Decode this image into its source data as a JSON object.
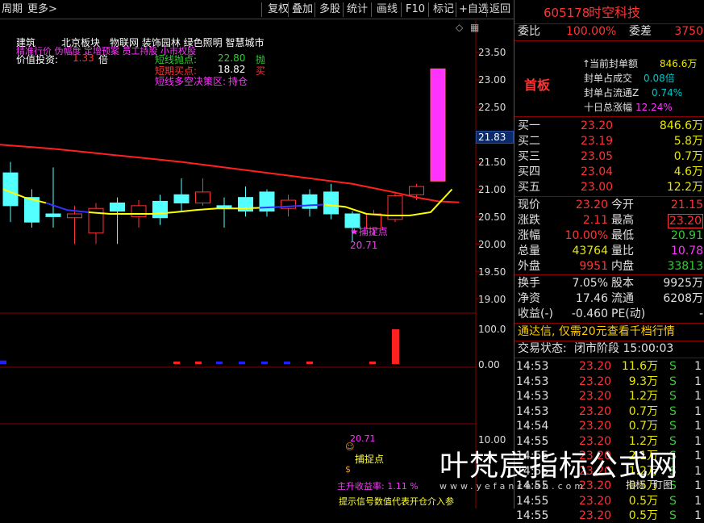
{
  "toolbar": {
    "left": [
      "周期",
      "更多>"
    ],
    "right": [
      "复权",
      "叠加",
      "多股",
      "统计",
      "画线",
      "F10",
      "标记",
      "+自选",
      "返回"
    ]
  },
  "chart_info": {
    "line1": [
      "建筑",
      "北京板块",
      "物联网 装饰园林 绿色照明 智慧城市"
    ],
    "line1b": "精准行价 伪幅度 定增预案 员工持股 小市权股",
    "value_label": "价值投资:",
    "value": "1.33",
    "value_unit": "倍",
    "short_sell_label": "短线抛点:",
    "short_sell": "22.80",
    "short_sell_tag": "抛",
    "short_buy_label": "短期买点:",
    "short_buy": "18.82",
    "short_buy_tag": "买",
    "strategy_label": "短线多空决策区:",
    "strategy": "持仓",
    "current_price_tag": "21.83",
    "capture_label": "★捕捉点",
    "capture_price": "20.71"
  },
  "indicator_bottom": {
    "price": "20.71",
    "capture": "捕捉点",
    "income": "主升收益率: 1.11 %",
    "hint": "提示信号数值代表开仓介入参"
  },
  "price_axis": [
    "23.50",
    "23.00",
    "22.50",
    "22.00",
    "21.50",
    "21.00",
    "20.50",
    "20.00",
    "19.50",
    "19.00"
  ],
  "vol_axis": [
    "100.0",
    "0.00"
  ],
  "ind_axis": [
    "10.00"
  ],
  "chart_data": {
    "type": "candlestick",
    "ylim": [
      18.8,
      23.7
    ],
    "candles": [
      {
        "o": 21.3,
        "c": 20.7,
        "h": 21.5,
        "l": 20.4
      },
      {
        "o": 20.85,
        "c": 20.4,
        "h": 21.0,
        "l": 20.3
      },
      {
        "o": 20.55,
        "c": 20.5,
        "h": 21.4,
        "l": 20.3
      },
      {
        "o": 20.48,
        "c": 20.55,
        "h": 20.7,
        "l": 20.0
      },
      {
        "o": 20.2,
        "c": 20.65,
        "h": 20.75,
        "l": 20.0
      },
      {
        "o": 20.75,
        "c": 20.6,
        "h": 20.85,
        "l": 20.0
      },
      {
        "o": 20.5,
        "c": 20.7,
        "h": 20.8,
        "l": 20.3
      },
      {
        "o": 20.78,
        "c": 20.48,
        "h": 20.9,
        "l": 20.35
      },
      {
        "o": 20.9,
        "c": 20.75,
        "h": 21.2,
        "l": 20.6
      },
      {
        "o": 20.75,
        "c": 20.95,
        "h": 21.2,
        "l": 20.7
      },
      {
        "o": 20.7,
        "c": 20.65,
        "h": 20.85,
        "l": 20.3
      },
      {
        "o": 20.85,
        "c": 20.6,
        "h": 21.05,
        "l": 20.5
      },
      {
        "o": 20.95,
        "c": 20.6,
        "h": 21.0,
        "l": 20.5
      },
      {
        "o": 20.65,
        "c": 20.8,
        "h": 20.9,
        "l": 20.5
      },
      {
        "o": 20.9,
        "c": 20.65,
        "h": 21.0,
        "l": 20.5
      },
      {
        "o": 20.95,
        "c": 20.55,
        "h": 21.1,
        "l": 20.45
      },
      {
        "o": 20.55,
        "c": 20.3,
        "h": 20.6,
        "l": 20.05
      },
      {
        "o": 20.28,
        "c": 20.55,
        "h": 20.62,
        "l": 20.15
      },
      {
        "o": 20.45,
        "c": 20.88,
        "h": 20.95,
        "l": 20.4
      },
      {
        "o": 20.9,
        "c": 21.05,
        "h": 21.1,
        "l": 20.8
      },
      {
        "o": 21.15,
        "c": 23.2,
        "h": 23.2,
        "l": 21.15
      }
    ],
    "ma_red": [
      21.83,
      21.8,
      21.77,
      21.74,
      21.7,
      21.66,
      21.62,
      21.58,
      21.54,
      21.5,
      21.45,
      21.4,
      21.35,
      21.3,
      21.25,
      21.2,
      21.15,
      21.1,
      21.02,
      20.94,
      20.85,
      20.78,
      20.76
    ],
    "ma_yellow": [
      21.0,
      20.85,
      20.75,
      20.62,
      20.58,
      20.55,
      20.55,
      20.55,
      20.58,
      20.62,
      20.65,
      20.65,
      20.66,
      20.68,
      20.7,
      20.72,
      20.68,
      20.55,
      20.52,
      20.52,
      20.58,
      21.0
    ],
    "volume": [
      {
        "v": 10,
        "up": false
      },
      {
        "v": 4,
        "up": true
      },
      {
        "v": 4,
        "up": true
      },
      {
        "v": 4,
        "up": false
      },
      {
        "v": 4,
        "up": false
      },
      {
        "v": 4,
        "up": false
      },
      {
        "v": 4,
        "up": false
      },
      {
        "v": 4,
        "up": true
      },
      {
        "v": 4,
        "up": true
      },
      {
        "v": 100,
        "up": true
      }
    ]
  },
  "panel": {
    "code": "605178",
    "name": "时空科技",
    "webi_label": "委比",
    "webi": "100.00%",
    "weicha_label": "委差",
    "weicha": "3750",
    "limit_up_label": "首板",
    "seal_amount_label": "当前封单额",
    "seal_amount": "846.6万",
    "seal_ratio_label": "封单占成交",
    "seal_ratio": "0.08倍",
    "seal_float_label": "封单占流通Z",
    "seal_float": "0.74%",
    "ten_day_label": "十日总涨幅",
    "ten_day": "12.24%",
    "bids": [
      {
        "label": "买一",
        "price": "23.20",
        "vol": "846.6万"
      },
      {
        "label": "买二",
        "price": "23.19",
        "vol": "5.8万"
      },
      {
        "label": "买三",
        "price": "23.05",
        "vol": "0.7万"
      },
      {
        "label": "买四",
        "price": "23.04",
        "vol": "4.6万"
      },
      {
        "label": "买五",
        "price": "23.00",
        "vol": "12.2万"
      }
    ],
    "stats": [
      {
        "l1": "现价",
        "v1": "23.20",
        "l2": "今开",
        "v2": "21.15",
        "c1": "red",
        "c2": "red"
      },
      {
        "l1": "涨跌",
        "v1": "2.11",
        "l2": "最高",
        "v2": "23.20",
        "c1": "red",
        "c2": "red"
      },
      {
        "l1": "涨幅",
        "v1": "10.00%",
        "l2": "最低",
        "v2": "20.91",
        "c1": "red",
        "c2": "green"
      },
      {
        "l1": "总量",
        "v1": "43764",
        "l2": "量比",
        "v2": "10.78",
        "c1": "yellow",
        "c2": "mag"
      },
      {
        "l1": "外盘",
        "v1": "9951",
        "l2": "内盘",
        "v2": "33813",
        "c1": "red",
        "c2": "green"
      }
    ],
    "stats2": [
      {
        "l1": "换手",
        "v1": "7.05%",
        "l2": "股本",
        "v2": "9925万"
      },
      {
        "l1": "净资",
        "v1": "17.46",
        "l2": "流通",
        "v2": "6208万"
      },
      {
        "l1": "收益(-)",
        "v1": "-0.460",
        "l2": "PE(动)",
        "v2": "-"
      }
    ],
    "ad": "通达信, 仅需20元查看千档行情",
    "trade_status_label": "交易状态:",
    "trade_status": "闭市阶段 15:00:03",
    "ticks": [
      {
        "t": "14:53",
        "p": "23.20",
        "v": "11.6万",
        "s": "S",
        "n": "1"
      },
      {
        "t": "14:53",
        "p": "23.20",
        "v": "9.3万",
        "s": "S",
        "n": "1"
      },
      {
        "t": "14:53",
        "p": "23.20",
        "v": "1.2万",
        "s": "S",
        "n": "1"
      },
      {
        "t": "14:53",
        "p": "23.20",
        "v": "0.7万",
        "s": "S",
        "n": "1"
      },
      {
        "t": "14:54",
        "p": "23.20",
        "v": "0.7万",
        "s": "S",
        "n": "1"
      },
      {
        "t": "14:55",
        "p": "23.20",
        "v": "1.2万",
        "s": "S",
        "n": "1"
      },
      {
        "t": "14:55",
        "p": "23.20",
        "v": "2.1万",
        "s": "S",
        "n": "1"
      },
      {
        "t": "14:55",
        "p": "23.20",
        "v": "1.2万",
        "s": "S",
        "n": "1"
      },
      {
        "t": "14:55",
        "p": "23.20",
        "v": "0.5万",
        "s": "S",
        "n": "1"
      },
      {
        "t": "14:55",
        "p": "23.20",
        "v": "0.5万",
        "s": "S",
        "n": "1"
      },
      {
        "t": "14:55",
        "p": "23.20",
        "v": "0.5万",
        "s": "S",
        "n": "1"
      }
    ],
    "tabs": [
      "指标",
      "盯图"
    ]
  },
  "watermark": {
    "text": "叶梵宸指标公式网",
    "url": "www.yefanchen.com"
  }
}
